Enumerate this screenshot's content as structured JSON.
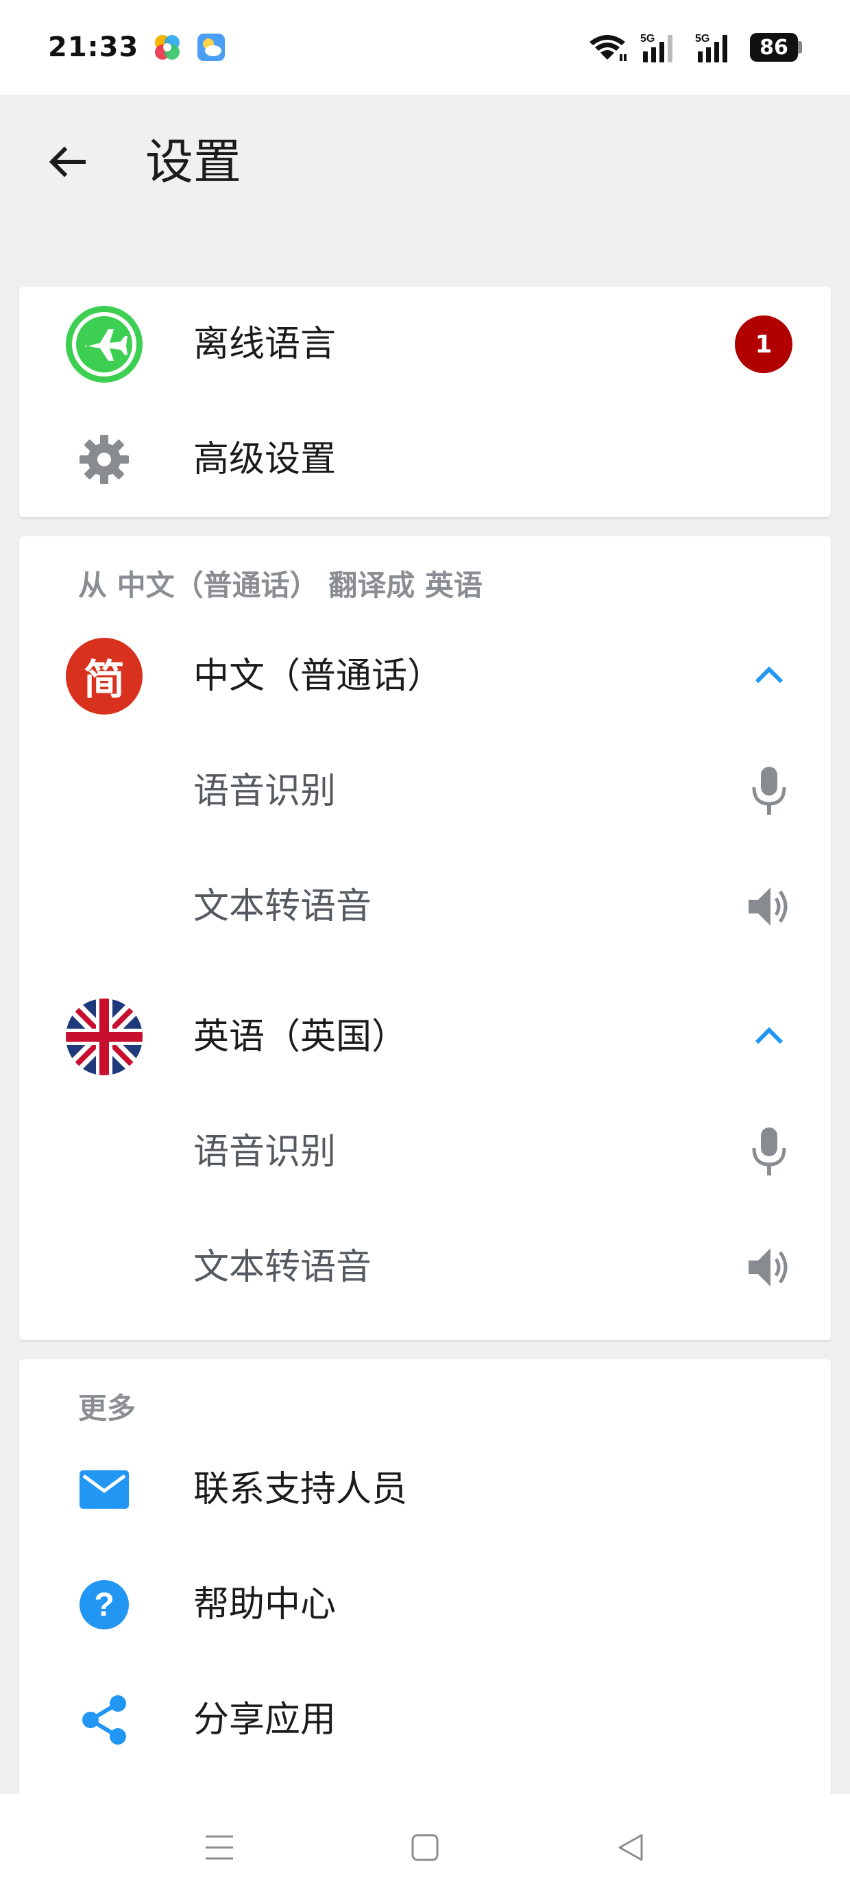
{
  "status": {
    "time": "21:33",
    "battery": "86",
    "network_1": "5G",
    "network_2": "5G"
  },
  "header": {
    "title": "设置"
  },
  "main_card": {
    "items": [
      {
        "label": "离线语言",
        "badge": "1",
        "icon": "airplane-icon"
      },
      {
        "label": "高级设置",
        "icon": "gear-icon"
      }
    ]
  },
  "translate_card": {
    "header": "从 中文（普通话） 翻译成 英语",
    "source": {
      "label": "中文（普通话）",
      "flag_text": "简",
      "items": [
        {
          "label": "语音识别",
          "icon": "mic-icon"
        },
        {
          "label": "文本转语音",
          "icon": "speaker-icon"
        }
      ]
    },
    "target": {
      "label": "英语（英国）",
      "items": [
        {
          "label": "语音识别",
          "icon": "mic-icon"
        },
        {
          "label": "文本转语音",
          "icon": "speaker-icon"
        }
      ]
    }
  },
  "more_card": {
    "header": "更多",
    "items": [
      {
        "label": "联系支持人员",
        "icon": "mail-icon"
      },
      {
        "label": "帮助中心",
        "icon": "help-icon"
      },
      {
        "label": "分享应用",
        "icon": "share-icon"
      }
    ]
  },
  "colors": {
    "accent": "#2196f3",
    "badge": "#b00000",
    "offline_green": "#3ccf52",
    "flag_red": "#d8321f",
    "icon_gray": "#888c90"
  }
}
